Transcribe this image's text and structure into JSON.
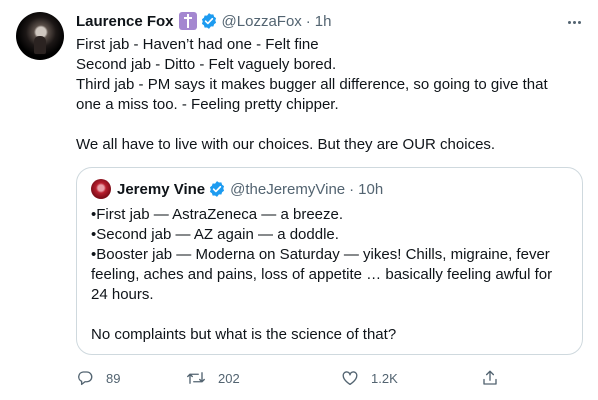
{
  "tweet": {
    "author_name": "Laurence Fox",
    "author_handle": "@LozzaFox",
    "separator": "·",
    "time": "1h",
    "lines": [
      "First jab - Haven’t had one - Felt fine",
      "Second jab - Ditto - Felt vaguely bored.",
      "Third jab - PM says it makes bugger all difference, so going to give that one a miss too. - Feeling pretty chipper."
    ],
    "closing": "We all have to live with our choices. But they are OUR choices."
  },
  "quote": {
    "author_name": "Jeremy Vine",
    "author_handle": "@theJeremyVine",
    "separator": "·",
    "time": "10h",
    "lines": [
      "•First jab — AstraZeneca — a breeze.",
      "•Second jab — AZ again — a doddle.",
      "•Booster jab — Moderna on Saturday — yikes! Chills, migraine, fever feeling, aches and pains, loss of appetite … basically feeling awful for 24 hours."
    ],
    "closing": "No complaints but what is the science of that?"
  },
  "actions": {
    "reply_count": "89",
    "retweet_count": "202",
    "like_count": "1.2K"
  },
  "icons": {
    "more": "more-options-icon",
    "badge": "cross-badge-icon",
    "verified": "verified-badge-icon",
    "reply": "reply-icon",
    "retweet": "retweet-icon",
    "like": "heart-icon",
    "share": "share-icon"
  },
  "colors": {
    "text": "#0f1419",
    "secondary": "#536471",
    "verified": "#1d9bf0",
    "border": "#cfd9de",
    "badge": "#a487d0"
  }
}
